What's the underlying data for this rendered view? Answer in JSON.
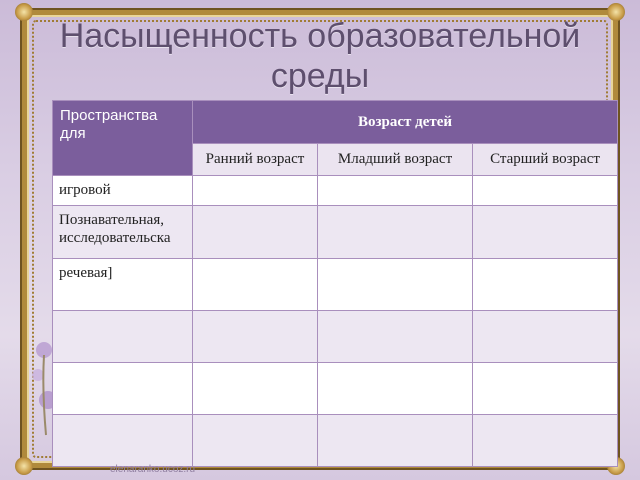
{
  "slide": {
    "title_line1": "Насыщенность образовательной",
    "title_line2": "среды",
    "footer_site": "elenaranko.ucoz.ru"
  },
  "table": {
    "header_left": "Пространства для",
    "header_main": "Возраст детей",
    "subheaders": [
      "Ранний возраст",
      "Младший возраст",
      "Старший возраст"
    ],
    "rows": [
      "игровой",
      "Познавательная, исследовательска",
      "речевая]",
      "",
      "",
      ""
    ]
  },
  "colors": {
    "header_purple": "#7b5e9c",
    "title_text": "#5e4f6e",
    "frame_gold": "#b08a3c"
  }
}
